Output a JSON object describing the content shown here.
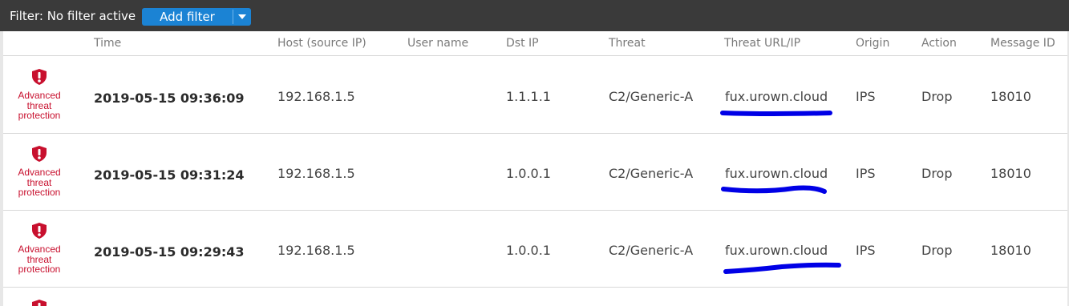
{
  "filter_bar": {
    "label": "Filter: No filter active",
    "add_filter_label": "Add filter"
  },
  "columns": {
    "time": "Time",
    "host": "Host (source IP)",
    "user": "User name",
    "dst_ip": "Dst IP",
    "threat": "Threat",
    "threat_url": "Threat URL/IP",
    "origin": "Origin",
    "action": "Action",
    "message_id": "Message ID"
  },
  "rows": [
    {
      "category": "Advanced threat protection",
      "category_lines": [
        "Advanced",
        "threat",
        "protection"
      ],
      "time": "2019-05-15 09:36:09",
      "host": "192.168.1.5",
      "user": "",
      "dst_ip": "1.1.1.1",
      "threat": "C2/Generic-A",
      "threat_url": "fux.urown.cloud",
      "origin": "IPS",
      "action": "Drop",
      "message_id": "18010"
    },
    {
      "category": "Advanced threat protection",
      "category_lines": [
        "Advanced",
        "threat",
        "protection"
      ],
      "time": "2019-05-15 09:31:24",
      "host": "192.168.1.5",
      "user": "",
      "dst_ip": "1.0.0.1",
      "threat": "C2/Generic-A",
      "threat_url": "fux.urown.cloud",
      "origin": "IPS",
      "action": "Drop",
      "message_id": "18010"
    },
    {
      "category": "Advanced threat protection",
      "category_lines": [
        "Advanced",
        "threat",
        "protection"
      ],
      "time": "2019-05-15 09:29:43",
      "host": "192.168.1.5",
      "user": "",
      "dst_ip": "1.0.0.1",
      "threat": "C2/Generic-A",
      "threat_url": "fux.urown.cloud",
      "origin": "IPS",
      "action": "Drop",
      "message_id": "18010"
    }
  ],
  "colors": {
    "filter_bar_bg": "#3a3a3a",
    "accent_button": "#1b83d4",
    "threat_red": "#c8102e",
    "annotation_blue": "#0000e6"
  },
  "icons": {
    "threat_category": "shield-exclamation-icon",
    "dropdown": "caret-down-icon"
  }
}
